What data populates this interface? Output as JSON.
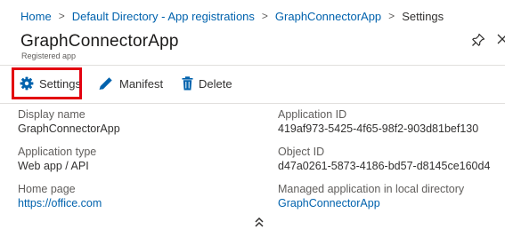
{
  "breadcrumb": {
    "items": [
      "Home",
      "Default Directory - App registrations",
      "GraphConnectorApp"
    ],
    "current": "Settings",
    "separator": ">"
  },
  "header": {
    "title": "GraphConnectorApp",
    "subtitle": "Registered app",
    "pin_icon": "pin-icon",
    "close_icon": "close-icon"
  },
  "toolbar": {
    "settings_label": "Settings",
    "settings_icon": "gear-icon",
    "manifest_label": "Manifest",
    "manifest_icon": "pencil-icon",
    "delete_label": "Delete",
    "delete_icon": "trash-icon",
    "highlight_color": "#e3000f",
    "accent_color": "#0062ad"
  },
  "essentials": {
    "left": [
      {
        "label": "Display name",
        "value": "GraphConnectorApp"
      },
      {
        "label": "Application type",
        "value": "Web app / API"
      },
      {
        "label": "Home page",
        "value": "https://office.com"
      }
    ],
    "right": [
      {
        "label": "Application ID",
        "value": "419af973-5425-4f65-98f2-903d81bef130"
      },
      {
        "label": "Object ID",
        "value": "d47a0261-5873-4186-bd57-d8145ce160d4"
      },
      {
        "label": "Managed application in local directory",
        "value": "GraphConnectorApp"
      }
    ],
    "collapse_icon": "double-chevron-up-icon"
  }
}
